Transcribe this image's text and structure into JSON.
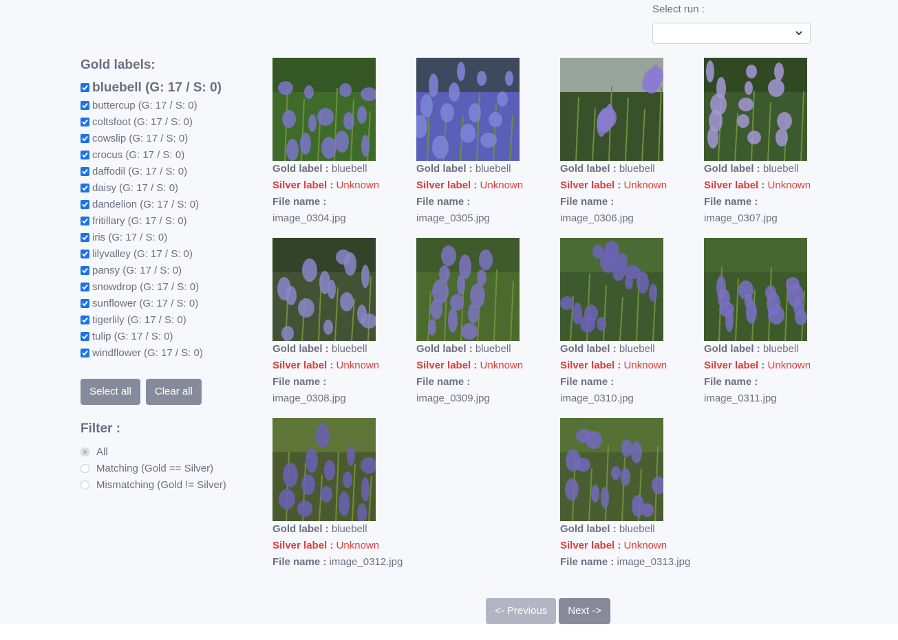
{
  "run_selector": {
    "label": "Select run :",
    "value": ""
  },
  "sidebar": {
    "gold_heading": "Gold labels:",
    "labels": [
      "bluebell (G: 17 / S: 0)",
      "buttercup (G: 17 / S: 0)",
      "coltsfoot (G: 17 / S: 0)",
      "cowslip (G: 17 / S: 0)",
      "crocus (G: 17 / S: 0)",
      "daffodil (G: 17 / S: 0)",
      "daisy (G: 17 / S: 0)",
      "dandelion (G: 17 / S: 0)",
      "fritillary (G: 17 / S: 0)",
      "iris (G: 17 / S: 0)",
      "lilyvalley (G: 17 / S: 0)",
      "pansy (G: 17 / S: 0)",
      "snowdrop (G: 17 / S: 0)",
      "sunflower (G: 17 / S: 0)",
      "tigerlily (G: 17 / S: 0)",
      "tulip (G: 17 / S: 0)",
      "windflower (G: 17 / S: 0)"
    ],
    "select_all": "Select all",
    "clear_all": "Clear all",
    "filter_heading": "Filter :",
    "filters": [
      "All",
      "Matching (Gold == Silver)",
      "Mismatching (Gold != Silver)"
    ]
  },
  "grid": {
    "gold_key": "Gold label :",
    "silver_key": "Silver label :",
    "file_key": "File name :",
    "cards": [
      {
        "gold": "bluebell",
        "silver": "Unknown",
        "file": "image_0304.jpg"
      },
      {
        "gold": "bluebell",
        "silver": "Unknown",
        "file": "image_0305.jpg"
      },
      {
        "gold": "bluebell",
        "silver": "Unknown",
        "file": "image_0306.jpg"
      },
      {
        "gold": "bluebell",
        "silver": "Unknown",
        "file": "image_0307.jpg"
      },
      {
        "gold": "bluebell",
        "silver": "Unknown",
        "file": "image_0308.jpg"
      },
      {
        "gold": "bluebell",
        "silver": "Unknown",
        "file": "image_0309.jpg"
      },
      {
        "gold": "bluebell",
        "silver": "Unknown",
        "file": "image_0310.jpg"
      },
      {
        "gold": "bluebell",
        "silver": "Unknown",
        "file": "image_0311.jpg"
      },
      {
        "gold": "bluebell",
        "silver": "Unknown",
        "file": "image_0312.jpg"
      },
      {
        "gold": "bluebell",
        "silver": "Unknown",
        "file": "image_0313.jpg"
      }
    ]
  },
  "pager": {
    "prev": "<- Previous",
    "next": "Next ->"
  },
  "colors": {
    "accent": "#1a73e8",
    "silver_text": "#e03c3c",
    "button": "#868a9b"
  }
}
